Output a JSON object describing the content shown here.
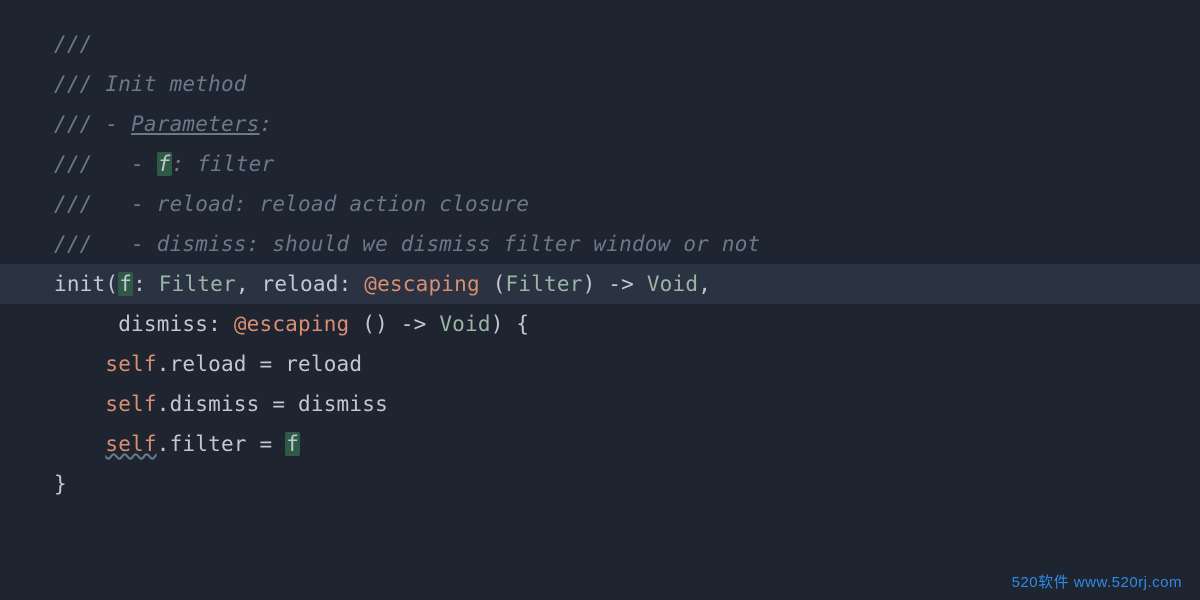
{
  "doc": {
    "slashes": "///",
    "bullet_dash": "-",
    "title_pre": " Init method",
    "params_label": "Parameters",
    "colon": ":",
    "p_f_name": "f",
    "p_f_desc": ": filter",
    "p_reload_name": "reload",
    "p_reload_desc": ": reload action closure",
    "p_dismiss_name": "dismiss",
    "p_dismiss_desc": ": should we dismiss filter window or not"
  },
  "sig": {
    "init": "init",
    "lparen": "(",
    "rparen": ")",
    "f_name": "f",
    "colon_sp": ": ",
    "filter_type": "Filter",
    "comma_sp": ", ",
    "reload_name": "reload",
    "at_escaping": "@escaping",
    "sp": " ",
    "arrow_void": " -> ",
    "void_type": "Void",
    "dismiss_name": "dismiss",
    "unit_parens": " ()",
    "brace_open": " {",
    "brace_close": "}"
  },
  "body": {
    "self_kw": "self",
    "dot": ".",
    "reload_prop": "reload",
    "eq": " = ",
    "reload_rhs": "reload",
    "dismiss_prop": "dismiss",
    "dismiss_rhs": "dismiss",
    "filter_prop": "filter",
    "f_rhs": "f"
  },
  "wm": {
    "brand": "520软件",
    "url": "www.520rj.com"
  }
}
